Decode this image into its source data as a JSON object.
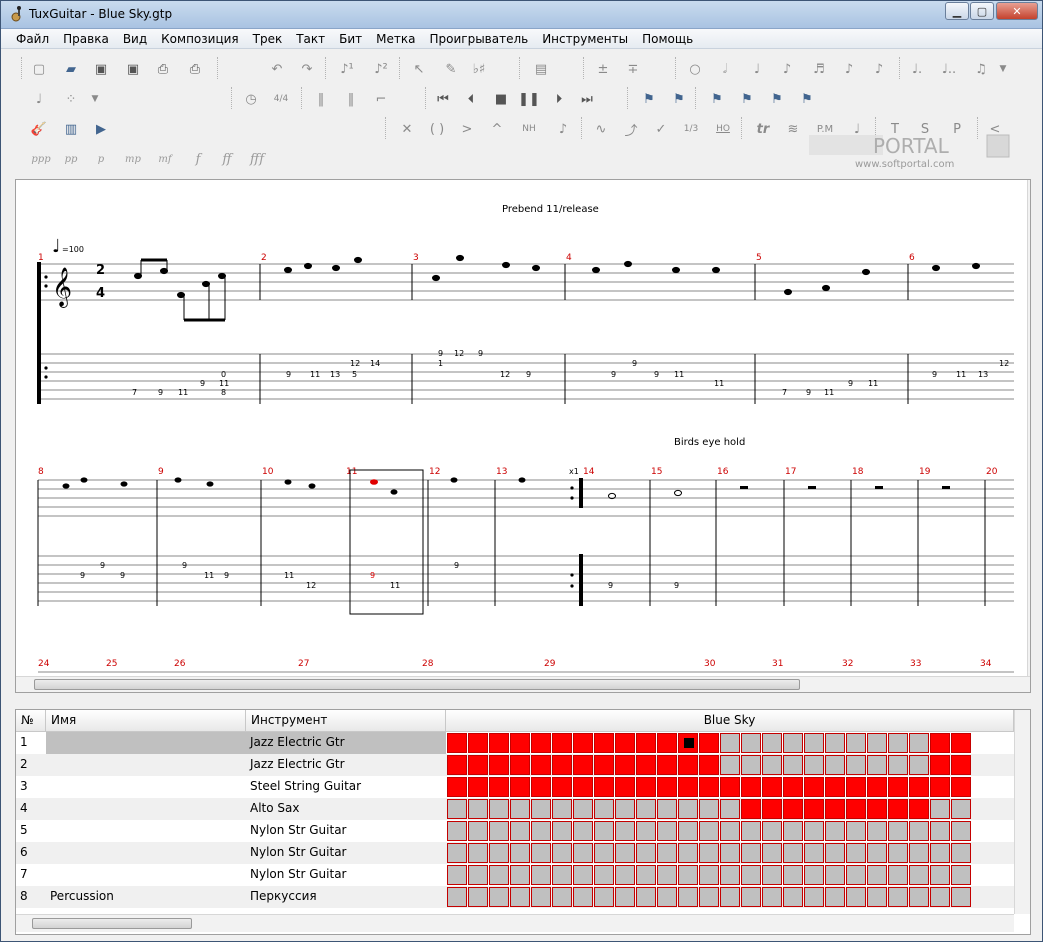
{
  "window": {
    "title": "TuxGuitar - Blue Sky.gtp"
  },
  "menu": [
    "Файл",
    "Правка",
    "Вид",
    "Композиция",
    "Трек",
    "Такт",
    "Бит",
    "Метка",
    "Проигрыватель",
    "Инструменты",
    "Помощь"
  ],
  "toolbar": {
    "dynamics": [
      "ppp",
      "pp",
      "p",
      "mp",
      "mf",
      "f",
      "ff",
      "fff"
    ],
    "effects_text": [
      "NH",
      "1/3",
      "HO",
      "tr",
      "P.M",
      "T",
      "S",
      "P"
    ]
  },
  "watermark": {
    "logo": "PORTAL",
    "url": "www.softportal.com"
  },
  "score": {
    "tempo": "=100",
    "time_signature": [
      "2",
      "4"
    ],
    "markers": [
      "Prebend 11/release",
      "Birds eye hold"
    ],
    "row1_measures": [
      "1",
      "2",
      "3",
      "4",
      "5",
      "6"
    ],
    "row2_measures": [
      "8",
      "9",
      "10",
      "11",
      "12",
      "13",
      "14",
      "15",
      "16",
      "17",
      "18",
      "19",
      "20"
    ],
    "row3_measures": [
      "24",
      "25",
      "26",
      "27",
      "28",
      "29",
      "30",
      "31",
      "32",
      "33",
      "34"
    ],
    "repeat_count": "x1",
    "tab_numbers_row1": [
      "7",
      "9",
      "11",
      "9",
      "0",
      "11",
      "8",
      "9",
      "11",
      "13",
      "12",
      "5",
      "14",
      "9",
      "12",
      "1",
      "9",
      "12",
      "9",
      "9",
      "9",
      "9",
      "11",
      "11",
      "7",
      "9",
      "11",
      "9",
      "11",
      "9",
      "11",
      "13",
      "12"
    ],
    "tab_numbers_row2": [
      "9",
      "9",
      "9",
      "9",
      "11",
      "9",
      "11",
      "12",
      "9",
      "11",
      "9",
      "9",
      "9"
    ]
  },
  "tracks": {
    "headers": {
      "number": "№",
      "name": "Имя",
      "instrument": "Инструмент",
      "song": "Blue Sky"
    },
    "rows": [
      {
        "number": "1",
        "name": "",
        "instrument": "Jazz Electric Gtr"
      },
      {
        "number": "2",
        "name": "",
        "instrument": "Jazz Electric Gtr"
      },
      {
        "number": "3",
        "name": "",
        "instrument": "Steel String Guitar"
      },
      {
        "number": "4",
        "name": "",
        "instrument": "Alto Sax"
      },
      {
        "number": "5",
        "name": "",
        "instrument": "Nylon Str Guitar"
      },
      {
        "number": "6",
        "name": "",
        "instrument": "Nylon Str Guitar"
      },
      {
        "number": "7",
        "name": "",
        "instrument": "Nylon Str Guitar"
      },
      {
        "number": "8",
        "name": "Percussion",
        "instrument": "Перкуссия"
      }
    ],
    "grid_pattern": [
      "1111111111111000000000011",
      "1111111111111000000000011",
      "1111111111111111111111111",
      "0000000000000011111111100",
      "0000000000000000000000000",
      "0000000000000000000000000",
      "0000000000000000000000000",
      "0000000000000000000000000"
    ],
    "selected_cell": {
      "row": 1,
      "col": 11
    }
  },
  "colors": {
    "accent": "#ff0000",
    "measure_number": "#cc0000",
    "selected_note": "#e00000"
  }
}
